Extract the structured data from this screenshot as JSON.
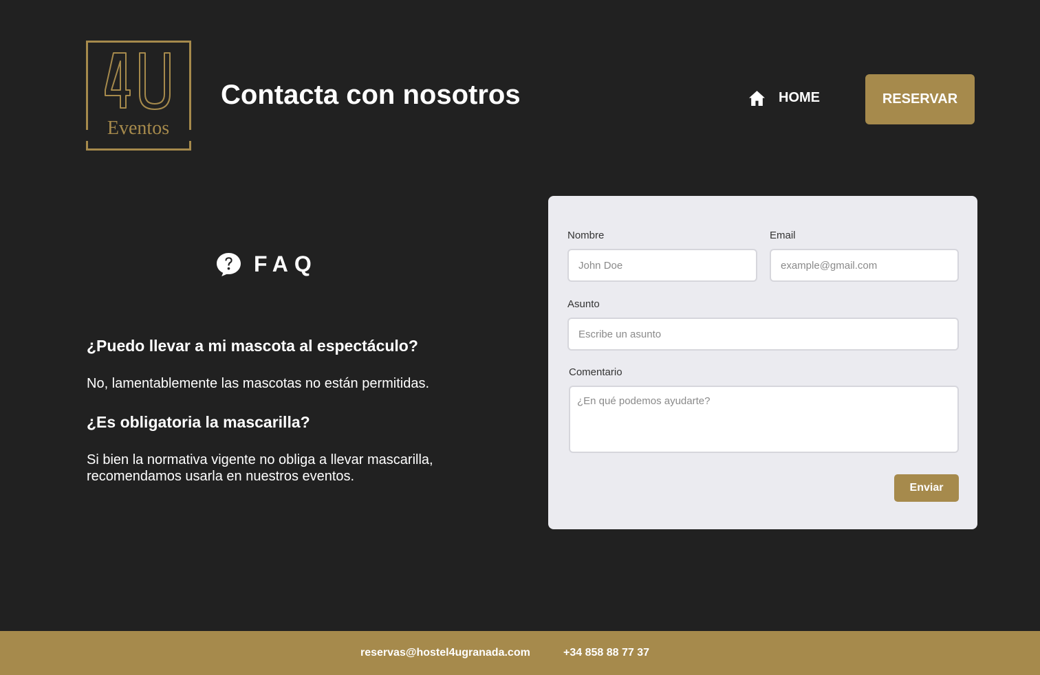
{
  "brand": {
    "logo_mark": "4U",
    "logo_word": "Eventos",
    "accent_color": "#a68a4c",
    "background_color": "#212121",
    "logo_icon": "4u-eventos-logo"
  },
  "header": {
    "title": "Contacta con nosotros",
    "nav_home_label": "HOME",
    "nav_home_icon": "home-icon",
    "reserve_label": "RESERVAR"
  },
  "faq": {
    "icon": "question-bubble-icon",
    "title": "FAQ",
    "items": [
      {
        "question": "¿Puedo llevar a mi mascota al espectáculo?",
        "answer": "No, lamentablemente las mascotas no están permitidas."
      },
      {
        "question": "¿Es obligatoria la mascarilla?",
        "answer": "Si bien la normativa vigente no obliga a llevar mascarilla, recomendamos usarla en nuestros eventos."
      }
    ]
  },
  "form": {
    "name_label": "Nombre",
    "name_placeholder": "John Doe",
    "email_label": "Email",
    "email_placeholder": "example@gmail.com",
    "subject_label": "Asunto",
    "subject_placeholder": "Escribe un asunto",
    "comment_label": "Comentario",
    "comment_placeholder": "¿En qué podemos ayudarte?",
    "submit_label": "Enviar"
  },
  "footer": {
    "email": "reservas@hostel4ugranada.com",
    "phone": "+34 858 88 77 37"
  }
}
